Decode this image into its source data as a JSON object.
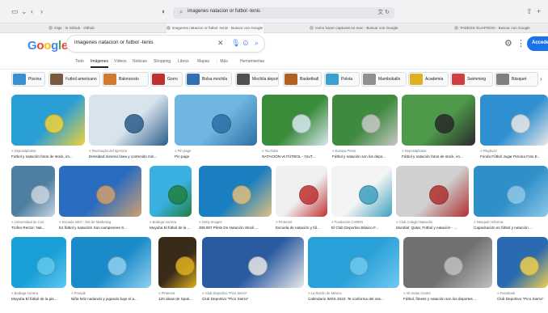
{
  "browser": {
    "address": "imagenes natacion or futbol -tenis",
    "tabs": [
      "Gigs · In Github · Github",
      "imagenes natacion or futbol -tenis - Buscar con Google",
      "como hacer capturas en mac - Buscar con Google",
      "TADEOS GUAPOOO - Buscar con Google"
    ]
  },
  "google": {
    "logo": [
      "G",
      "o",
      "o",
      "g",
      "l",
      "e"
    ],
    "logo_colors": [
      "#4285f4",
      "#ea4335",
      "#fbbc05",
      "#4285f4",
      "#34a853",
      "#ea4335"
    ],
    "query": "imagenes natacion or futbol -tenis",
    "signin": "Acceder",
    "nav": [
      "Todo",
      "Imágenes",
      "Vídeos",
      "Noticias",
      "Shopping",
      "Libros",
      "Mapas",
      "⋮ Más",
      "Herramientas"
    ],
    "active_nav": "Imágenes"
  },
  "chips": [
    {
      "label": "Piscina",
      "color": "#3a8fd0"
    },
    {
      "label": "Futbol americano",
      "color": "#7a5a3c"
    },
    {
      "label": "Baloncesto",
      "color": "#d07a30"
    },
    {
      "label": "Gorro",
      "color": "#c03030"
    },
    {
      "label": "Bolsa mochila",
      "color": "#3070b0"
    },
    {
      "label": "Mochila deportiva",
      "color": "#505050"
    },
    {
      "label": "Basketball",
      "color": "#b06020"
    },
    {
      "label": "Pelota",
      "color": "#3aa0d0"
    },
    {
      "label": "Mamboballo",
      "color": "#909090"
    },
    {
      "label": "Academia",
      "color": "#e0b020"
    },
    {
      "label": "Swimming",
      "color": "#d04040"
    },
    {
      "label": "Básquet",
      "color": "#808080"
    }
  ],
  "images": [
    {
      "src": "Depositphotos",
      "title": "Futbol y natación fotos de stock, im...",
      "c1": "#2a9fd6",
      "c2": "#f2d23a"
    },
    {
      "src": "Recreação del ejercicio",
      "title": "Densidad mineral ósea y contenido min...",
      "c1": "#d8e4ec",
      "c2": "#2a5d8a"
    },
    {
      "src": "Pin page",
      "title": "Pin page",
      "c1": "#6fb6e0",
      "c2": "#2d6fa6"
    },
    {
      "src": "YouTube",
      "title": "NATACIÓN vs FÚTBOL - YouT...",
      "c1": "#3a8b3a",
      "c2": "#d8e8f0"
    },
    {
      "src": "Europa Press",
      "title": "Fútbol y natación son los depo...",
      "c1": "#3e8a3e",
      "c2": "#c8c8c8"
    },
    {
      "src": "Depositphotos",
      "title": "Fútbol y natación fotos de stock, im...",
      "c1": "#4e9a4a",
      "c2": "#2a2a2a"
    },
    {
      "src": "Playbuzz",
      "title": "Fondo Fútbol Jugar Piscina Foto E...",
      "c1": "#2f8fd0",
      "c2": "#e8e8e8"
    },
    {
      "src": "Universidad de Cos",
      "title": "Trofeo Rector: Nat...",
      "c1": "#4f7fa0",
      "c2": "#c8d6e0"
    },
    {
      "src": "Escuela SEO - Ibiz de Marketing",
      "title": "Es fútbol y natación! Son campeones S...",
      "c1": "#2a6cc0",
      "c2": "#d0a070"
    },
    {
      "src": "Bodega Aurrera",
      "title": "Muyuba El fútbol de la ...",
      "c1": "#3ab0e0",
      "c2": "#208040"
    },
    {
      "src": "Getty Images",
      "title": "308.807 Pilots De Natación Stock ...",
      "c1": "#1a7fc0",
      "c2": "#e0c080"
    },
    {
      "src": "Pinterest",
      "title": "Escuela de natación y fúl...",
      "c1": "#f0f0f0",
      "c2": "#c03030"
    },
    {
      "src": "Fundación CAREN",
      "title": "El Club Deportivo Básico F...",
      "c1": "#f4f4f4",
      "c2": "#3aa0c0"
    },
    {
      "src": "Club Colegio Natación",
      "title": "Mundial: Qatar, Fútbol y natación - ...",
      "c1": "#d0d0d0",
      "c2": "#b03030"
    },
    {
      "src": "Neuquén Informa",
      "title": "Capacitación en fútbol y natación ...",
      "c1": "#2f8fc8",
      "c2": "#8cc8e8"
    },
    {
      "src": "Bodega Aurrera",
      "title": "Muyuba El fútbol de la pis...",
      "c1": "#1aa0d8",
      "c2": "#60c8f0"
    },
    {
      "src": "Freepik",
      "title": "Niña feliz nadando y jugando bajo el a...",
      "c1": "#1a8ac8",
      "c2": "#90d0f0"
    },
    {
      "src": "Pinterest",
      "title": "120 ideas de Spati...",
      "c1": "#3a2a1a",
      "c2": "#e0b020"
    },
    {
      "src": "Club Deportivo \"Pico Sierra\"",
      "title": "Club Deportivo \"Pico Sierra\"",
      "c1": "#2a5aa0",
      "c2": "#e8e8e8"
    },
    {
      "src": "La Razón de México",
      "title": "Calendario IMSS 2022: Te conforma del ose...",
      "c1": "#2aa0d8",
      "c2": "#70c8f0"
    },
    {
      "src": "Ab Veiao Center",
      "title": "Fútbol, fitness y natación son los deportes ...",
      "c1": "#707070",
      "c2": "#c0c0c0"
    },
    {
      "src": "Facebook",
      "title": "Club Deportivo \"Pico Sierra\"",
      "c1": "#2a6ab0",
      "c2": "#f0d050"
    }
  ]
}
